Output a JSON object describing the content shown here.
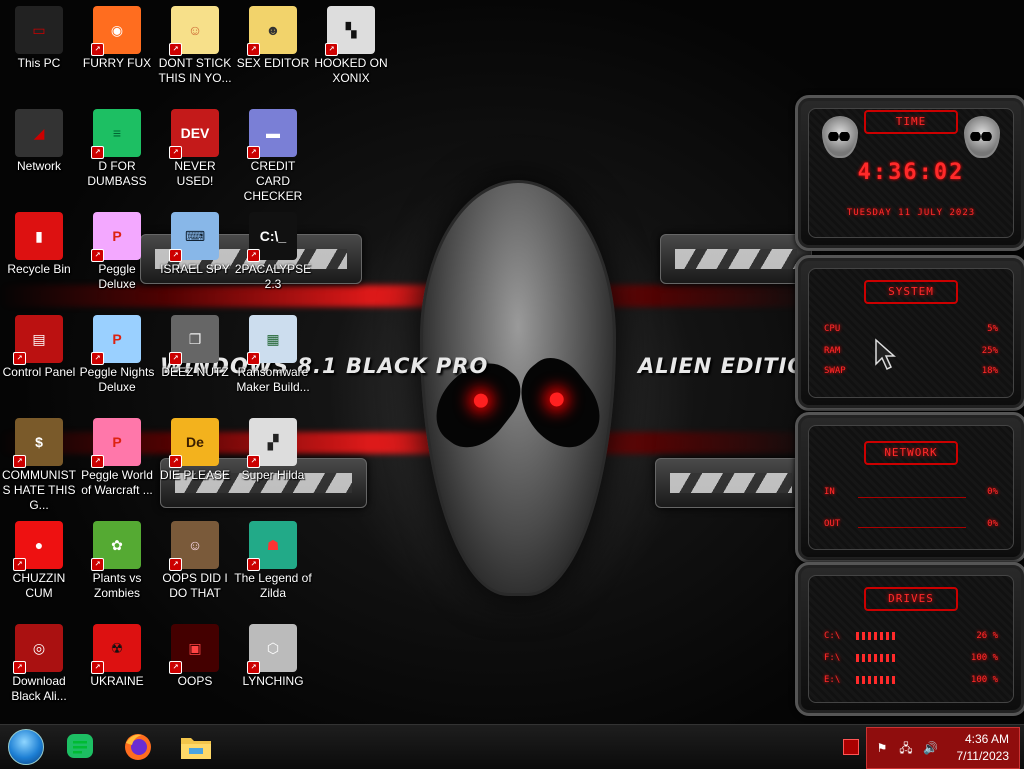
{
  "wallpaper": {
    "left_title": "WINDOWS 8.1 BLACK PRO",
    "right_title": "ALIEN EDITION 20",
    "accent": "#ff1a1a"
  },
  "desktop_icons": [
    {
      "label": "This PC",
      "icon": "monitor-icon"
    },
    {
      "label": "FURRY FUX",
      "icon": "firefox-icon"
    },
    {
      "label": "DONT STICK THIS IN YO...",
      "icon": "cartoon-girl-icon"
    },
    {
      "label": "SEX EDITOR",
      "icon": "cartoon-character-icon"
    },
    {
      "label": "HOOKED ON XONIX",
      "icon": "xonix-game-icon"
    },
    {
      "label": "Network",
      "icon": "network-icon"
    },
    {
      "label": "D FOR DUMBASS",
      "icon": "green-chat-icon"
    },
    {
      "label": "NEVER USED!",
      "icon": "dev-cpp-icon"
    },
    {
      "label": "CREDIT CARD CHECKER",
      "icon": "credit-card-icon"
    },
    {
      "label": "Recycle Bin",
      "icon": "recycle-bin-icon"
    },
    {
      "label": "Peggle Deluxe",
      "icon": "peggle-icon"
    },
    {
      "label": "ISRAEL SPY",
      "icon": "spy-computer-icon"
    },
    {
      "label": "2PACALYPSE 2.3",
      "icon": "terminal-icon"
    },
    {
      "label": "Control Panel",
      "icon": "control-panel-icon"
    },
    {
      "label": "Peggle Nights Deluxe",
      "icon": "peggle-nights-icon"
    },
    {
      "label": "DEEZ NUTZ",
      "icon": "stacked-windows-icon"
    },
    {
      "label": "Ransomware Maker Build...",
      "icon": "ransomware-window-icon"
    },
    {
      "label": "COMMUNISTS HATE THIS G...",
      "icon": "money-bag-icon"
    },
    {
      "label": "Peggle World of Warcraft ...",
      "icon": "peggle-wow-icon"
    },
    {
      "label": "DIE PLEASE",
      "icon": "adobe-dimension-icon"
    },
    {
      "label": "Super Hilda",
      "icon": "pixel-character-icon"
    },
    {
      "label": "CHUZZIN CUM",
      "icon": "chuzzle-icon"
    },
    {
      "label": "Plants vs Zombies",
      "icon": "plant-flower-icon"
    },
    {
      "label": "OOPS DID I DO THAT",
      "icon": "portrait-painting-icon"
    },
    {
      "label": "The Legend of Zilda",
      "icon": "pixel-hero-icon"
    },
    {
      "label": "Download Black Ali...",
      "icon": "alien-orb-icon"
    },
    {
      "label": "UKRAINE",
      "icon": "radiation-icon"
    },
    {
      "label": "OOPS",
      "icon": "red-window-icon"
    },
    {
      "label": "LYNCHING",
      "icon": "hex-emblem-icon"
    }
  ],
  "gadgets": {
    "time": {
      "header": "TIME",
      "clock": "4:36:02",
      "date": "TUESDAY 11 JULY 2023"
    },
    "system": {
      "header": "SYSTEM",
      "rows": [
        {
          "label": "CPU",
          "value": "5%"
        },
        {
          "label": "RAM",
          "value": "25%"
        },
        {
          "label": "SWAP",
          "value": "18%"
        }
      ]
    },
    "network": {
      "header": "NETWORK",
      "rows": [
        {
          "label": "IN",
          "value": "0%"
        },
        {
          "label": "OUT",
          "value": "0%"
        }
      ]
    },
    "drives": {
      "header": "DRIVES",
      "rows": [
        {
          "label": "C:\\",
          "value": "26 %"
        },
        {
          "label": "F:\\",
          "value": "100 %"
        },
        {
          "label": "E:\\",
          "value": "100 %"
        }
      ]
    }
  },
  "taskbar": {
    "pinned": [
      "start-orb-icon",
      "green-chat-icon",
      "firefox-icon",
      "file-explorer-icon"
    ],
    "tray": {
      "time": "4:36 AM",
      "date": "7/11/2023"
    }
  }
}
